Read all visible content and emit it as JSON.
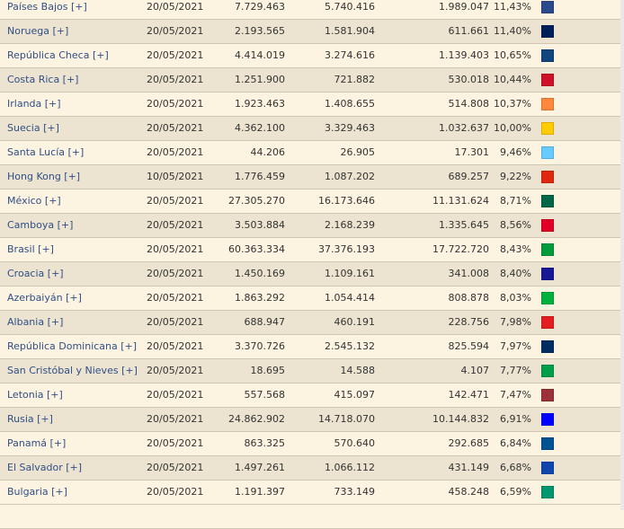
{
  "rows": [
    {
      "country": "Países Bajos [+]",
      "date": "20/05/2021",
      "c1": "7.729.463",
      "c2": "5.740.416",
      "c3": "1.989.047",
      "pct": "11,43%",
      "color": "#2b4a8c"
    },
    {
      "country": "Noruega [+]",
      "date": "20/05/2021",
      "c1": "2.193.565",
      "c2": "1.581.904",
      "c3": "611.661",
      "pct": "11,40%",
      "color": "#00205b"
    },
    {
      "country": "República Checa [+]",
      "date": "20/05/2021",
      "c1": "4.414.019",
      "c2": "3.274.616",
      "c3": "1.139.403",
      "pct": "10,65%",
      "color": "#11457e"
    },
    {
      "country": "Costa Rica [+]",
      "date": "20/05/2021",
      "c1": "1.251.900",
      "c2": "721.882",
      "c3": "530.018",
      "pct": "10,44%",
      "color": "#ce1126"
    },
    {
      "country": "Irlanda [+]",
      "date": "20/05/2021",
      "c1": "1.923.463",
      "c2": "1.408.655",
      "c3": "514.808",
      "pct": "10,37%",
      "color": "#ff883e"
    },
    {
      "country": "Suecia [+]",
      "date": "20/05/2021",
      "c1": "4.362.100",
      "c2": "3.329.463",
      "c3": "1.032.637",
      "pct": "10,00%",
      "color": "#fecc00"
    },
    {
      "country": "Santa Lucía [+]",
      "date": "20/05/2021",
      "c1": "44.206",
      "c2": "26.905",
      "c3": "17.301",
      "pct": "9,46%",
      "color": "#66ccff"
    },
    {
      "country": "Hong Kong [+]",
      "date": "10/05/2021",
      "c1": "1.776.459",
      "c2": "1.087.202",
      "c3": "689.257",
      "pct": "9,22%",
      "color": "#de2910"
    },
    {
      "country": "México [+]",
      "date": "20/05/2021",
      "c1": "27.305.270",
      "c2": "16.173.646",
      "c3": "11.131.624",
      "pct": "8,71%",
      "color": "#006847"
    },
    {
      "country": "Camboya [+]",
      "date": "20/05/2021",
      "c1": "3.503.884",
      "c2": "2.168.239",
      "c3": "1.335.645",
      "pct": "8,56%",
      "color": "#e00025"
    },
    {
      "country": "Brasil [+]",
      "date": "20/05/2021",
      "c1": "60.363.334",
      "c2": "37.376.193",
      "c3": "17.722.720",
      "pct": "8,43%",
      "color": "#009c3b"
    },
    {
      "country": "Croacia [+]",
      "date": "20/05/2021",
      "c1": "1.450.169",
      "c2": "1.109.161",
      "c3": "341.008",
      "pct": "8,40%",
      "color": "#171796"
    },
    {
      "country": "Azerbaiyán [+]",
      "date": "20/05/2021",
      "c1": "1.863.292",
      "c2": "1.054.414",
      "c3": "808.878",
      "pct": "8,03%",
      "color": "#00b140"
    },
    {
      "country": "Albania [+]",
      "date": "20/05/2021",
      "c1": "688.947",
      "c2": "460.191",
      "c3": "228.756",
      "pct": "7,98%",
      "color": "#e41e20"
    },
    {
      "country": "República Dominicana [+]",
      "date": "20/05/2021",
      "c1": "3.370.726",
      "c2": "2.545.132",
      "c3": "825.594",
      "pct": "7,97%",
      "color": "#002d62"
    },
    {
      "country": "San Cristóbal y Nieves [+]",
      "date": "20/05/2021",
      "c1": "18.695",
      "c2": "14.588",
      "c3": "4.107",
      "pct": "7,77%",
      "color": "#009e49"
    },
    {
      "country": "Letonia [+]",
      "date": "20/05/2021",
      "c1": "557.568",
      "c2": "415.097",
      "c3": "142.471",
      "pct": "7,47%",
      "color": "#9e3039"
    },
    {
      "country": "Rusia [+]",
      "date": "20/05/2021",
      "c1": "24.862.902",
      "c2": "14.718.070",
      "c3": "10.144.832",
      "pct": "6,91%",
      "color": "#0000ff"
    },
    {
      "country": "Panamá [+]",
      "date": "20/05/2021",
      "c1": "863.325",
      "c2": "570.640",
      "c3": "292.685",
      "pct": "6,84%",
      "color": "#005293"
    },
    {
      "country": "El Salvador [+]",
      "date": "20/05/2021",
      "c1": "1.497.261",
      "c2": "1.066.112",
      "c3": "431.149",
      "pct": "6,68%",
      "color": "#0f47af"
    },
    {
      "country": "Bulgaria [+]",
      "date": "20/05/2021",
      "c1": "1.191.397",
      "c2": "733.149",
      "c3": "458.248",
      "pct": "6,59%",
      "color": "#00966e"
    }
  ]
}
